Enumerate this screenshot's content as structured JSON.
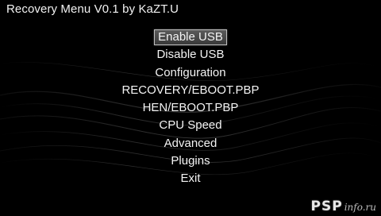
{
  "header": {
    "title": "Recovery Menu V0.1 by KaZT.U"
  },
  "menu": {
    "items": [
      {
        "label": "Enable USB",
        "selected": true
      },
      {
        "label": "Disable USB",
        "selected": false
      },
      {
        "label": "Configuration",
        "selected": false
      },
      {
        "label": "RECOVERY/EBOOT.PBP",
        "selected": false
      },
      {
        "label": "HEN/EBOOT.PBP",
        "selected": false
      },
      {
        "label": "CPU Speed",
        "selected": false
      },
      {
        "label": "Advanced",
        "selected": false
      },
      {
        "label": "Plugins",
        "selected": false
      },
      {
        "label": "Exit",
        "selected": false
      }
    ]
  },
  "watermark": {
    "brand": "PSP",
    "suffix": "info.ru"
  },
  "colors": {
    "background": "#000000",
    "text": "#f4f4f4",
    "selection_border": "#bdbdbd"
  }
}
